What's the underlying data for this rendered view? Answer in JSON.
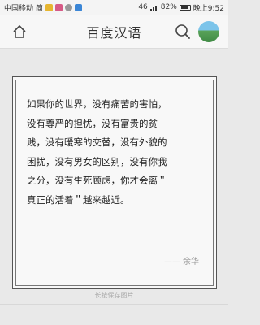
{
  "status_bar": {
    "carrier": "中国移动 简",
    "signal": "46",
    "battery": "82%",
    "time": "晚上9:52"
  },
  "header": {
    "title": "百度汉语"
  },
  "quote_card": {
    "lines": [
      "如果你的世界，没有痛苦的害怕，",
      "没有尊严的担忧，没有富贵的贫",
      "贱，没有暖寒的交替，没有外貌的",
      "困扰，没有男女的区别，没有你我",
      "之分，没有生死顾虑，你才会离＂",
      "真正的活着＂越来越近。"
    ],
    "author": "—— 余华"
  },
  "footer": {
    "save_hint": "长按保存图片"
  },
  "icons": {
    "home": "home-icon",
    "search": "search-icon",
    "avatar": "avatar"
  }
}
